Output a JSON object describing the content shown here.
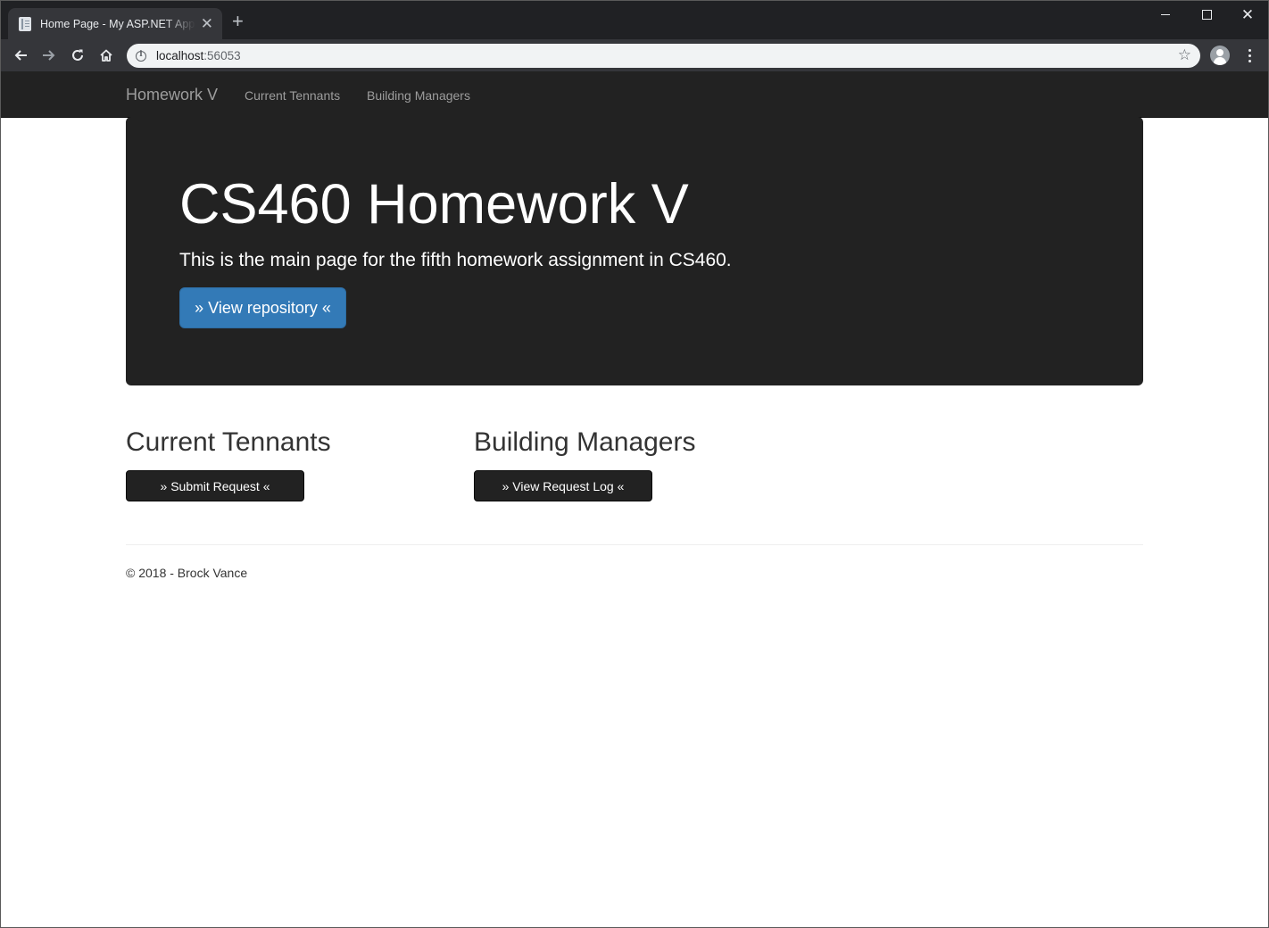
{
  "browser": {
    "tab_title": "Home Page - My ASP.NET Application",
    "url_host": "localhost",
    "url_port": ":56053"
  },
  "navbar": {
    "brand": "Homework V",
    "links": [
      "Current Tennants",
      "Building Managers"
    ]
  },
  "jumbotron": {
    "heading": "CS460 Homework V",
    "lead": "This is the main page for the fifth homework assignment in CS460.",
    "button_label": "» View repository «"
  },
  "sections": [
    {
      "heading": "Current Tennants",
      "button_label": "» Submit Request «"
    },
    {
      "heading": "Building Managers",
      "button_label": "» View Request Log «"
    }
  ],
  "footer": {
    "text": "© 2018 - Brock Vance"
  },
  "colors": {
    "navbar_bg": "#222222",
    "primary": "#337ab7",
    "chrome_dark": "#202124"
  }
}
